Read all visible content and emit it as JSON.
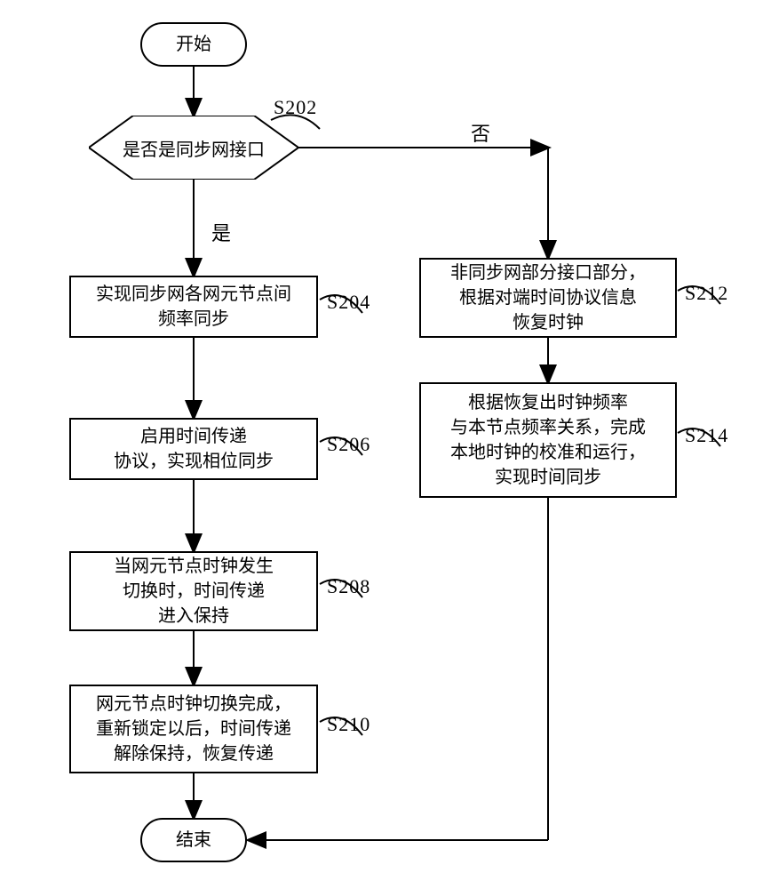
{
  "terminator": {
    "start": "开始",
    "end": "结束"
  },
  "decision": {
    "text": "是否是同步网接口",
    "yes": "是",
    "no": "否"
  },
  "steps": {
    "s202": "S202",
    "s204": "S204",
    "s206": "S206",
    "s208": "S208",
    "s210": "S210",
    "s212": "S212",
    "s214": "S214"
  },
  "process": {
    "p204": "实现同步网各网元节点间\n频率同步",
    "p206": "启用时间传递\n协议，实现相位同步",
    "p208": "当网元节点时钟发生\n切换时，时间传递\n进入保持",
    "p210": "网元节点时钟切换完成，\n重新锁定以后，时间传递\n解除保持，恢复传递",
    "p212": "非同步网部分接口部分，\n根据对端时间协议信息\n恢复时钟",
    "p214": "根据恢复出时钟频率\n与本节点频率关系，完成\n本地时钟的校准和运行，\n实现时间同步"
  }
}
